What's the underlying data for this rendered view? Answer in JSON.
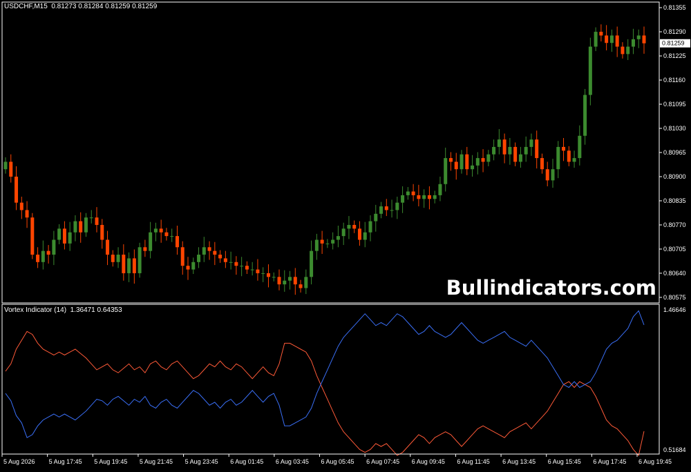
{
  "colors": {
    "background": "#000000",
    "frame": "#ffffff",
    "bull": "#3c8b2f",
    "bear": "#ff4500",
    "vi_plus": "#3a6ff7",
    "vi_minus": "#ff5a38",
    "text": "#ffffff",
    "price_badge_bg": "#ffffff",
    "price_badge_text": "#000000"
  },
  "main_chart": {
    "title": "USDCHF,M15  0.81273 0.81284 0.81259 0.81259",
    "watermark": "Bullindicators.com",
    "price_badge": "0.81259",
    "price_badge_value": 0.81259
  },
  "indicator": {
    "title": "Vortex Indicator (14)  1.36471 0.64353"
  },
  "chart_data": [
    {
      "type": "candlestick",
      "title": "USDCHF,M15  0.81273 0.81284 0.81259 0.81259",
      "ylim": [
        0.8056,
        0.8137
      ],
      "y_ticks": [
        "0.81355",
        "0.81290",
        "0.81225",
        "0.81160",
        "0.81095",
        "0.81030",
        "0.80965",
        "0.80900",
        "0.80835",
        "0.80770",
        "0.80705",
        "0.80640",
        "0.80575"
      ],
      "x_ticks": [
        "5 Aug 2026",
        "5 Aug 17:45",
        "5 Aug 19:45",
        "5 Aug 21:45",
        "5 Aug 23:45",
        "6 Aug 01:45",
        "6 Aug 03:45",
        "6 Aug 05:45",
        "6 Aug 07:45",
        "6 Aug 09:45",
        "6 Aug 11:45",
        "6 Aug 13:45",
        "6 Aug 15:45",
        "6 Aug 17:45",
        "6 Aug 19:45"
      ],
      "closes": [
        0.8094,
        0.809,
        0.8083,
        0.8081,
        0.8079,
        0.8069,
        0.8067,
        0.807,
        0.8069,
        0.8073,
        0.8076,
        0.8072,
        0.8075,
        0.8078,
        0.8075,
        0.8079,
        0.8079,
        0.8077,
        0.8073,
        0.8069,
        0.8067,
        0.8069,
        0.8064,
        0.8068,
        0.8064,
        0.8071,
        0.807,
        0.8075,
        0.8076,
        0.8075,
        0.8074,
        0.8074,
        0.8071,
        0.8066,
        0.8065,
        0.8067,
        0.8069,
        0.8071,
        0.807,
        0.8069,
        0.8068,
        0.8067,
        0.8067,
        0.8066,
        0.8066,
        0.8065,
        0.8065,
        0.8064,
        0.8064,
        0.8063,
        0.8063,
        0.8061,
        0.8062,
        0.8063,
        0.8061,
        0.806,
        0.8063,
        0.807,
        0.8073,
        0.8072,
        0.8072,
        0.8073,
        0.8074,
        0.8076,
        0.8077,
        0.8076,
        0.8073,
        0.8075,
        0.8078,
        0.808,
        0.8082,
        0.8081,
        0.8081,
        0.8083,
        0.8085,
        0.8086,
        0.8085,
        0.8084,
        0.8085,
        0.8084,
        0.8085,
        0.8088,
        0.8095,
        0.8094,
        0.8092,
        0.8096,
        0.8092,
        0.8093,
        0.8095,
        0.8094,
        0.8096,
        0.8098,
        0.81,
        0.8096,
        0.8098,
        0.8094,
        0.8096,
        0.8098,
        0.81,
        0.8095,
        0.8092,
        0.8089,
        0.8092,
        0.8098,
        0.8097,
        0.8094,
        0.8095,
        0.8101,
        0.8112,
        0.8125,
        0.8129,
        0.8128,
        0.8126,
        0.8128,
        0.8125,
        0.8123,
        0.8125,
        0.8127,
        0.8128,
        0.81259
      ],
      "vi_plus": [
        0.9,
        0.85,
        0.75,
        0.7,
        0.6,
        0.62,
        0.68,
        0.72,
        0.74,
        0.76,
        0.74,
        0.76,
        0.74,
        0.72,
        0.75,
        0.78,
        0.82,
        0.86,
        0.85,
        0.82,
        0.86,
        0.88,
        0.85,
        0.82,
        0.86,
        0.84,
        0.88,
        0.82,
        0.8,
        0.84,
        0.86,
        0.82,
        0.8,
        0.84,
        0.88,
        0.92,
        0.9,
        0.86,
        0.82,
        0.84,
        0.8,
        0.84,
        0.86,
        0.82,
        0.84,
        0.88,
        0.92,
        0.88,
        0.84,
        0.88,
        0.9,
        0.82,
        0.68,
        0.68,
        0.7,
        0.72,
        0.74,
        0.8,
        0.9,
        0.98,
        1.06,
        1.14,
        1.22,
        1.28,
        1.32,
        1.36,
        1.4,
        1.44,
        1.4,
        1.36,
        1.38,
        1.36,
        1.4,
        1.44,
        1.42,
        1.38,
        1.34,
        1.3,
        1.32,
        1.36,
        1.32,
        1.3,
        1.28,
        1.3,
        1.34,
        1.38,
        1.34,
        1.3,
        1.26,
        1.24,
        1.26,
        1.28,
        1.3,
        1.32,
        1.28,
        1.26,
        1.24,
        1.22,
        1.26,
        1.22,
        1.18,
        1.14,
        1.08,
        1.02,
        0.96,
        0.94,
        0.98,
        0.94,
        0.96,
        0.98,
        1.04,
        1.12,
        1.2,
        1.24,
        1.26,
        1.3,
        1.34,
        1.42,
        1.46,
        1.36471
      ],
      "vi_minus": [
        1.05,
        1.1,
        1.2,
        1.26,
        1.32,
        1.3,
        1.24,
        1.2,
        1.18,
        1.16,
        1.18,
        1.16,
        1.18,
        1.2,
        1.17,
        1.14,
        1.1,
        1.06,
        1.08,
        1.1,
        1.06,
        1.04,
        1.07,
        1.1,
        1.06,
        1.08,
        1.04,
        1.1,
        1.12,
        1.08,
        1.06,
        1.1,
        1.12,
        1.08,
        1.04,
        1.0,
        1.02,
        1.06,
        1.1,
        1.08,
        1.12,
        1.08,
        1.06,
        1.1,
        1.08,
        1.04,
        1.0,
        1.04,
        1.08,
        1.04,
        1.02,
        1.1,
        1.24,
        1.24,
        1.22,
        1.2,
        1.18,
        1.12,
        1.02,
        0.94,
        0.86,
        0.78,
        0.7,
        0.64,
        0.6,
        0.56,
        0.52,
        0.5,
        0.52,
        0.56,
        0.54,
        0.56,
        0.52,
        0.48,
        0.5,
        0.54,
        0.58,
        0.62,
        0.6,
        0.56,
        0.6,
        0.62,
        0.64,
        0.62,
        0.58,
        0.54,
        0.58,
        0.62,
        0.66,
        0.68,
        0.66,
        0.64,
        0.62,
        0.6,
        0.64,
        0.66,
        0.68,
        0.7,
        0.66,
        0.7,
        0.74,
        0.78,
        0.84,
        0.9,
        0.96,
        0.98,
        0.94,
        0.98,
        0.96,
        0.94,
        0.88,
        0.8,
        0.72,
        0.68,
        0.66,
        0.62,
        0.58,
        0.52,
        0.48,
        0.64353
      ]
    },
    {
      "type": "line",
      "title": "Vortex Indicator (14)  1.36471 0.64353",
      "ylim": [
        0.5168,
        1.4665
      ],
      "y_ticks": [
        "1.46646",
        "0.51684"
      ]
    }
  ]
}
